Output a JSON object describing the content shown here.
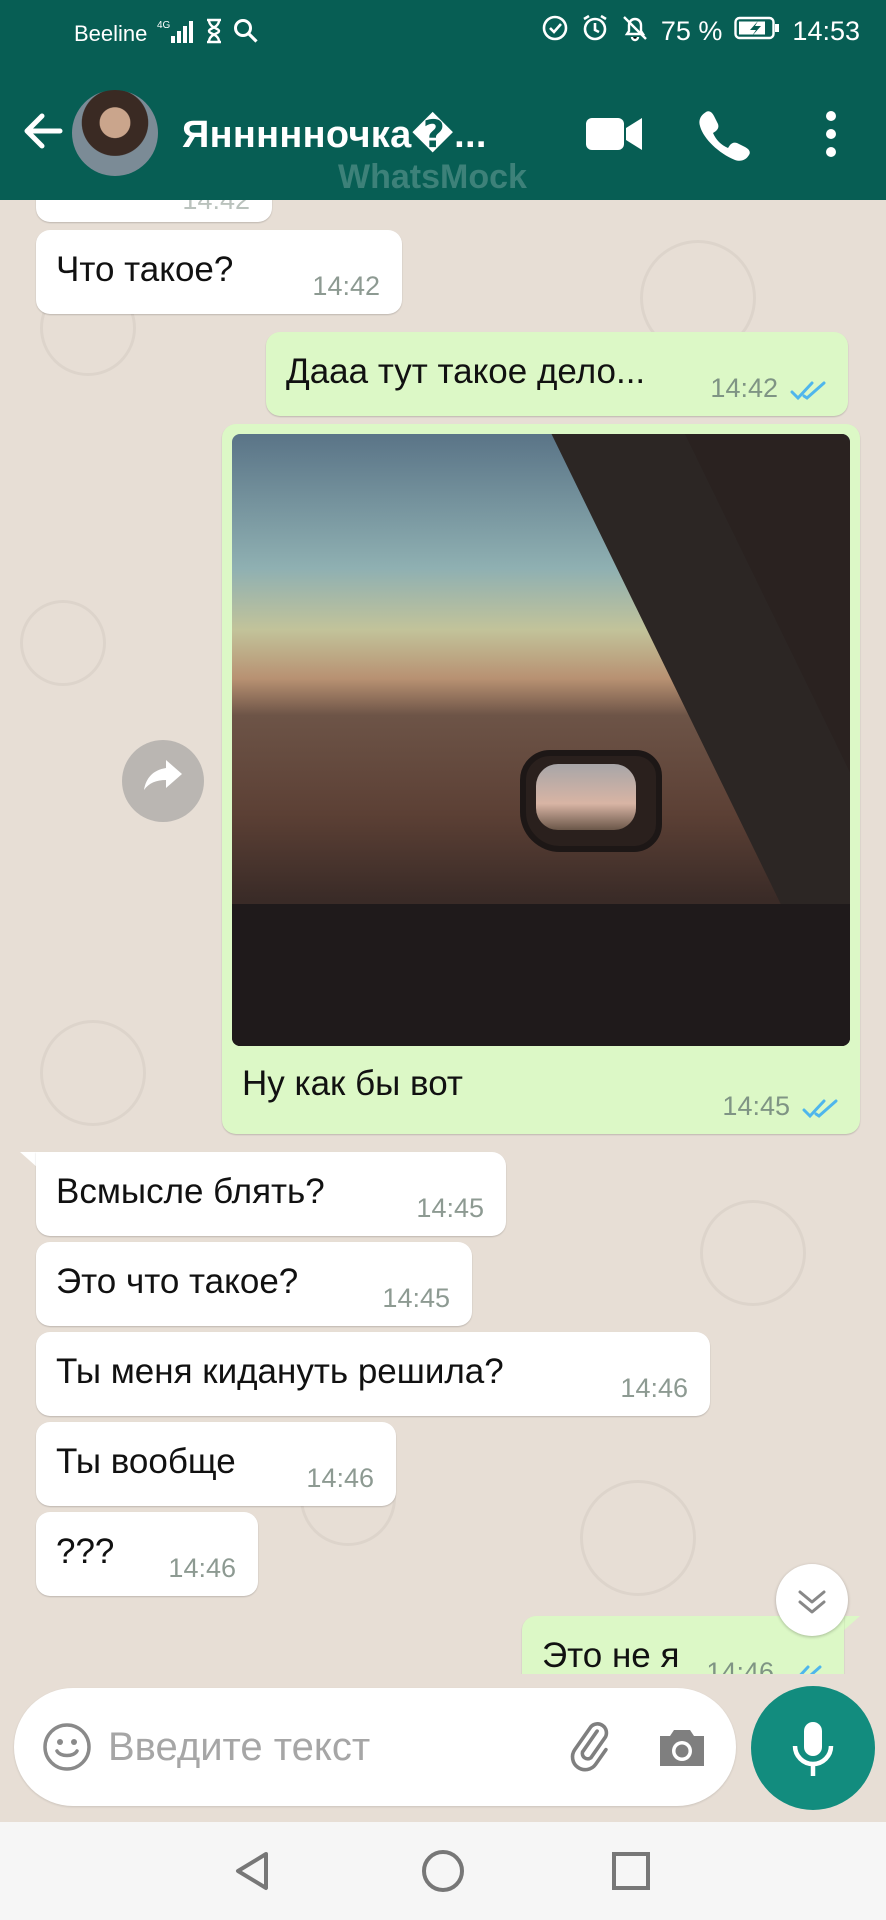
{
  "status_bar": {
    "carrier": "Beeline",
    "network": "4G",
    "battery": "75 %",
    "time": "14:53"
  },
  "header": {
    "contact_name": "Яннннночка�...",
    "watermark": "WhatsMock"
  },
  "messages": [
    {
      "direction": "in",
      "text": "Что такое?",
      "time": "14:42"
    },
    {
      "direction": "out",
      "text": "Дааа тут такое дело...",
      "time": "14:42",
      "read": true
    },
    {
      "direction": "out",
      "type": "image",
      "caption": "Ну как бы вот",
      "time": "14:45",
      "read": true
    },
    {
      "direction": "in",
      "text": "Всмысле блять?",
      "time": "14:45"
    },
    {
      "direction": "in",
      "text": "Это что такое?",
      "time": "14:45"
    },
    {
      "direction": "in",
      "text": "Ты меня кидануть решила?",
      "time": "14:46"
    },
    {
      "direction": "in",
      "text": "Ты вообще",
      "time": "14:46"
    },
    {
      "direction": "in",
      "text": "???",
      "time": "14:46"
    },
    {
      "direction": "out",
      "text": "Это не я",
      "time": "14:46",
      "read": true
    }
  ],
  "partial_top_time": "14:42",
  "input": {
    "placeholder": "Введите текст"
  },
  "colors": {
    "header": "#075e54",
    "outgoing_bubble": "#dcf8c6",
    "incoming_bubble": "#ffffff",
    "chat_bg": "#e7ded5",
    "mic_button": "#128c7e",
    "read_ticks": "#4fb6ec"
  },
  "icons": {
    "back": "arrow-left-icon",
    "video": "video-camera-icon",
    "call": "phone-icon",
    "menu": "more-vertical-icon",
    "forward": "forward-icon",
    "scroll": "chevron-double-down-icon",
    "emoji": "smiley-icon",
    "attach": "paperclip-icon",
    "camera": "camera-icon",
    "mic": "microphone-icon"
  }
}
